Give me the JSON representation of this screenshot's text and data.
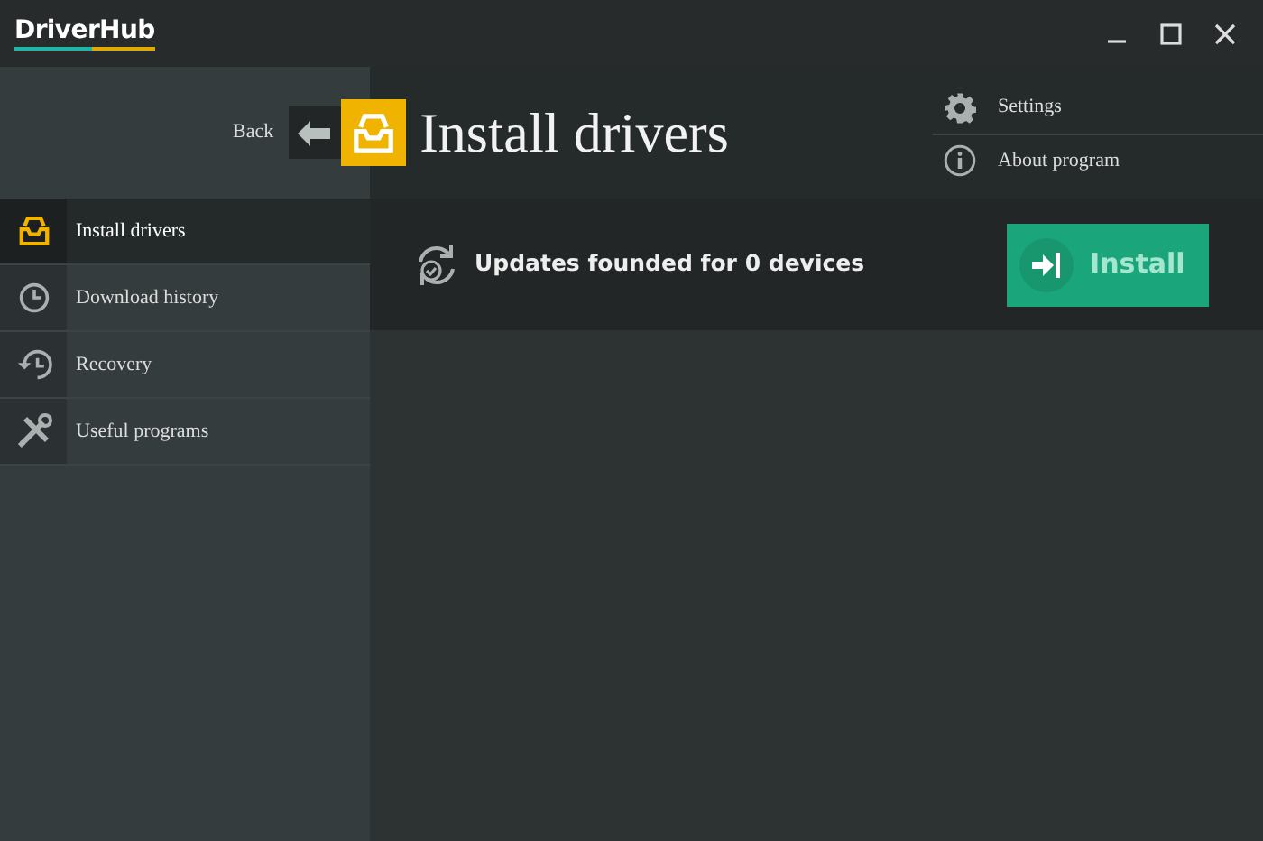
{
  "window": {
    "title": "DriverHub",
    "controls": [
      {
        "kind": "minimize"
      },
      {
        "kind": "maximize"
      },
      {
        "kind": "close"
      }
    ]
  },
  "header": {
    "back": "Back",
    "title": "Install drivers"
  },
  "menu": [
    {
      "label": "Settings",
      "kind": "settings"
    },
    {
      "label": "About program",
      "kind": "about"
    }
  ],
  "sidebar": {
    "items": [
      {
        "label": "Install drivers",
        "kind": "install",
        "selected": true
      },
      {
        "label": "Download history",
        "kind": "history",
        "selected": false
      },
      {
        "label": "Recovery",
        "kind": "recovery",
        "selected": false
      },
      {
        "label": "Useful programs",
        "kind": "tools",
        "selected": false
      }
    ]
  },
  "status": {
    "text": "Updates founded for 0 devices"
  },
  "install_button": {
    "label": "Install",
    "disabled": true
  }
}
